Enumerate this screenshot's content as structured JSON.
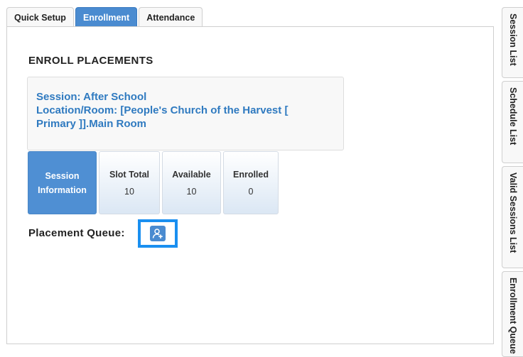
{
  "tabs": [
    {
      "label": "Quick Setup",
      "active": false
    },
    {
      "label": "Enrollment",
      "active": true
    },
    {
      "label": "Attendance",
      "active": false
    }
  ],
  "enroll": {
    "heading": "ENROLL PLACEMENTS",
    "session_line": "Session: After School",
    "location_line1": "Location/Room: [People's Church of the Harvest [",
    "location_line2": "Primary ]].Main Room"
  },
  "cards": {
    "session_info_line1": "Session",
    "session_info_line2": "Information",
    "slot_total_label": "Slot Total",
    "slot_total_value": "10",
    "available_label": "Available",
    "available_value": "10",
    "enrolled_label": "Enrolled",
    "enrolled_value": "0"
  },
  "queue": {
    "label": "Placement Queue:",
    "button_icon": "add-user-icon"
  },
  "side_tabs": [
    {
      "label": "Session List"
    },
    {
      "label": "Schedule List"
    },
    {
      "label": "Valid Sessions List"
    },
    {
      "label": "Enrollment Queue"
    }
  ],
  "colors": {
    "accent": "#4a8bd0",
    "link_text": "#2f7ac0",
    "highlight_border": "#1a8ff0"
  }
}
